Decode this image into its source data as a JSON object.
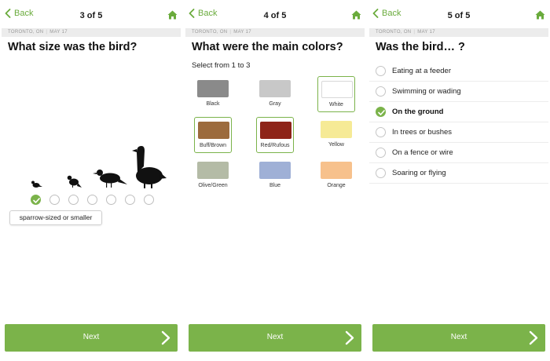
{
  "accent": "#7bb34a",
  "panels": [
    {
      "back_label": "Back",
      "step": "3 of 5",
      "location": "TORONTO, ON",
      "date": "MAY 17",
      "question": "What size was the bird?",
      "size_dots_count": 7,
      "selected_size_index": 0,
      "size_chip": "sparrow-sized or smaller",
      "next_label": "Next"
    },
    {
      "back_label": "Back",
      "step": "4 of 5",
      "location": "TORONTO, ON",
      "date": "MAY 17",
      "question": "What were the main colors?",
      "subtitle": "Select from 1 to 3",
      "colors": [
        {
          "label": "Black",
          "swatch": "#8a8a8a",
          "selected": false
        },
        {
          "label": "Gray",
          "swatch": "#c8c8c8",
          "selected": false
        },
        {
          "label": "White",
          "swatch": "#ffffff",
          "selected": true
        },
        {
          "label": "Buff/Brown",
          "swatch": "#9c6b3d",
          "selected": true
        },
        {
          "label": "Red/Rufous",
          "swatch": "#8e2418",
          "selected": true
        },
        {
          "label": "Yellow",
          "swatch": "#f6ea96",
          "selected": false
        },
        {
          "label": "Olive/Green",
          "swatch": "#b4bba6",
          "selected": false
        },
        {
          "label": "Blue",
          "swatch": "#9fb0d6",
          "selected": false
        },
        {
          "label": "Orange",
          "swatch": "#f7c18c",
          "selected": false
        }
      ],
      "next_label": "Next"
    },
    {
      "back_label": "Back",
      "step": "5 of 5",
      "location": "TORONTO, ON",
      "date": "MAY 17",
      "question": "Was the bird… ?",
      "options": [
        {
          "label": "Eating at a feeder",
          "selected": false
        },
        {
          "label": "Swimming or wading",
          "selected": false
        },
        {
          "label": "On the ground",
          "selected": true
        },
        {
          "label": "In trees or bushes",
          "selected": false
        },
        {
          "label": "On a fence or wire",
          "selected": false
        },
        {
          "label": "Soaring or flying",
          "selected": false
        }
      ],
      "next_label": "Next"
    }
  ]
}
